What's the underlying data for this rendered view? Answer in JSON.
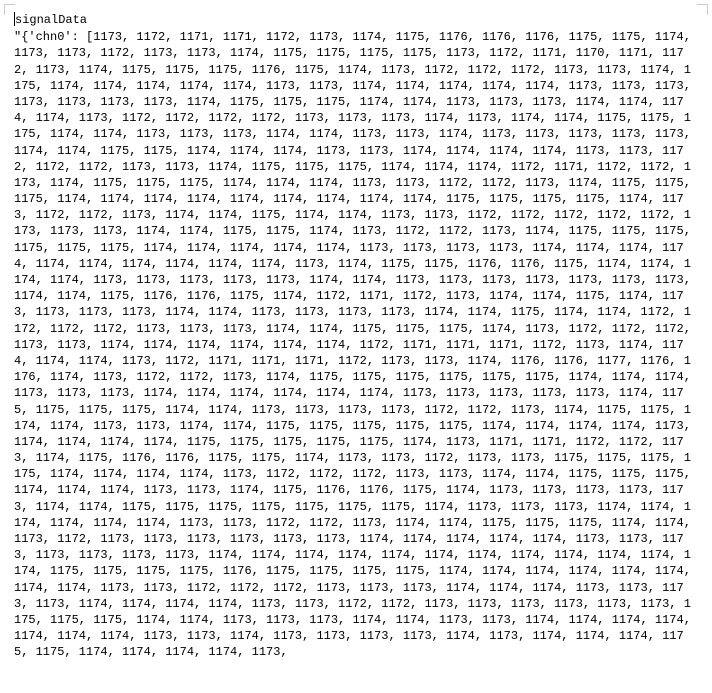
{
  "header": {
    "variable_name": "signalData"
  },
  "chart_data": {
    "type": "table",
    "title": "signalData",
    "key": "chn0",
    "prefix_literal": "\"{'chn0': [",
    "values": [
      1173,
      1172,
      1171,
      1171,
      1172,
      1173,
      1174,
      1175,
      1176,
      1176,
      1176,
      1175,
      1175,
      1174,
      1173,
      1173,
      1172,
      1173,
      1173,
      1174,
      1175,
      1175,
      1175,
      1175,
      1173,
      1172,
      1171,
      1170,
      1171,
      1172,
      1173,
      1174,
      1175,
      1175,
      1175,
      1176,
      1175,
      1174,
      1173,
      1172,
      1172,
      1172,
      1173,
      1173,
      1174,
      1175,
      1174,
      1174,
      1174,
      1174,
      1174,
      1173,
      1173,
      1174,
      1174,
      1174,
      1174,
      1174,
      1173,
      1173,
      1173,
      1173,
      1173,
      1173,
      1173,
      1174,
      1175,
      1175,
      1175,
      1174,
      1174,
      1173,
      1173,
      1173,
      1174,
      1174,
      1174,
      1174,
      1173,
      1172,
      1172,
      1172,
      1172,
      1173,
      1173,
      1173,
      1174,
      1173,
      1174,
      1174,
      1175,
      1175,
      1175,
      1174,
      1174,
      1173,
      1173,
      1173,
      1174,
      1174,
      1173,
      1173,
      1174,
      1173,
      1173,
      1173,
      1173,
      1173,
      1174,
      1174,
      1175,
      1175,
      1174,
      1174,
      1174,
      1173,
      1173,
      1174,
      1174,
      1174,
      1174,
      1173,
      1173,
      1172,
      1172,
      1172,
      1173,
      1173,
      1174,
      1175,
      1175,
      1175,
      1174,
      1174,
      1174,
      1172,
      1171,
      1172,
      1172,
      1173,
      1174,
      1175,
      1175,
      1175,
      1174,
      1174,
      1174,
      1173,
      1173,
      1172,
      1172,
      1173,
      1174,
      1175,
      1175,
      1175,
      1174,
      1174,
      1174,
      1174,
      1174,
      1174,
      1174,
      1174,
      1174,
      1175,
      1175,
      1175,
      1175,
      1174,
      1173,
      1172,
      1172,
      1173,
      1174,
      1174,
      1175,
      1174,
      1174,
      1173,
      1173,
      1172,
      1172,
      1172,
      1172,
      1172,
      1173,
      1173,
      1173,
      1174,
      1174,
      1175,
      1175,
      1174,
      1173,
      1172,
      1172,
      1173,
      1174,
      1175,
      1175,
      1175,
      1175,
      1175,
      1175,
      1174,
      1174,
      1174,
      1174,
      1174,
      1173,
      1173,
      1173,
      1173,
      1174,
      1174,
      1174,
      1174,
      1174,
      1174,
      1174,
      1174,
      1174,
      1174,
      1173,
      1174,
      1175,
      1175,
      1176,
      1176,
      1175,
      1174,
      1174,
      1174,
      1174,
      1173,
      1173,
      1173,
      1173,
      1173,
      1174,
      1174,
      1173,
      1173,
      1173,
      1173,
      1173,
      1173,
      1173,
      1174,
      1174,
      1175,
      1176,
      1176,
      1175,
      1174,
      1172,
      1171,
      1172,
      1173,
      1174,
      1174,
      1175,
      1174,
      1173,
      1173,
      1173,
      1173,
      1174,
      1174,
      1173,
      1173,
      1173,
      1173,
      1174,
      1174,
      1175,
      1174,
      1174,
      1172,
      1172,
      1172,
      1172,
      1173,
      1173,
      1173,
      1174,
      1174,
      1175,
      1175,
      1175,
      1174,
      1173,
      1172,
      1172,
      1172,
      1173,
      1173,
      1174,
      1174,
      1174,
      1174,
      1174,
      1174,
      1172,
      1171,
      1171,
      1171,
      1172,
      1173,
      1174,
      1174,
      1174,
      1174,
      1173,
      1172,
      1171,
      1171,
      1171,
      1172,
      1173,
      1173,
      1174,
      1176,
      1176,
      1177,
      1176,
      1176,
      1174,
      1173,
      1172,
      1172,
      1173,
      1174,
      1175,
      1175,
      1175,
      1175,
      1175,
      1175,
      1174,
      1174,
      1174,
      1173,
      1173,
      1173,
      1174,
      1174,
      1174,
      1174,
      1174,
      1174,
      1173,
      1173,
      1173,
      1173,
      1173,
      1174,
      1175,
      1175,
      1175,
      1175,
      1174,
      1174,
      1173,
      1173,
      1173,
      1173,
      1172,
      1172,
      1173,
      1174,
      1175,
      1175,
      1174,
      1174,
      1173,
      1173,
      1174,
      1174,
      1175,
      1175,
      1175,
      1175,
      1175,
      1174,
      1174,
      1174,
      1174,
      1173,
      1174,
      1174,
      1174,
      1174,
      1175,
      1175,
      1175,
      1175,
      1175,
      1174,
      1173,
      1171,
      1171,
      1172,
      1172,
      1173,
      1174,
      1175,
      1176,
      1176,
      1175,
      1175,
      1174,
      1173,
      1173,
      1172,
      1173,
      1173,
      1175,
      1175,
      1175,
      1175,
      1174,
      1174,
      1174,
      1174,
      1173,
      1172,
      1172,
      1172,
      1173,
      1173,
      1174,
      1174,
      1175,
      1175,
      1175,
      1174,
      1174,
      1174,
      1173,
      1173,
      1174,
      1175,
      1176,
      1176,
      1175,
      1174,
      1173,
      1173,
      1173,
      1173,
      1173,
      1174,
      1174,
      1175,
      1175,
      1175,
      1175,
      1175,
      1175,
      1175,
      1174,
      1173,
      1173,
      1173,
      1174,
      1174,
      1174,
      1174,
      1174,
      1174,
      1173,
      1173,
      1172,
      1172,
      1173,
      1174,
      1174,
      1175,
      1175,
      1175,
      1174,
      1174,
      1173,
      1172,
      1173,
      1173,
      1173,
      1173,
      1173,
      1173,
      1174,
      1174,
      1174,
      1174,
      1174,
      1173,
      1173,
      1173,
      1173,
      1173,
      1173,
      1173,
      1174,
      1174,
      1174,
      1174,
      1174,
      1174,
      1174,
      1174,
      1174,
      1174,
      1174,
      1174,
      1175,
      1175,
      1175,
      1175,
      1176,
      1175,
      1175,
      1175,
      1175,
      1174,
      1174,
      1174,
      1174,
      1174,
      1174,
      1174,
      1174,
      1173,
      1173,
      1172,
      1172,
      1172,
      1173,
      1173,
      1173,
      1174,
      1174,
      1174,
      1173,
      1173,
      1173,
      1173,
      1174,
      1174,
      1174,
      1174,
      1173,
      1173,
      1172,
      1172,
      1173,
      1173,
      1173,
      1173,
      1173,
      1173,
      1175,
      1175,
      1175,
      1174,
      1174,
      1173,
      1173,
      1173,
      1174,
      1174,
      1173,
      1173,
      1174,
      1174,
      1174,
      1174,
      1174,
      1174,
      1174,
      1173,
      1173,
      1174,
      1173,
      1173,
      1173,
      1173,
      1174,
      1173,
      1174,
      1174,
      1174,
      1175,
      1175,
      1174,
      1174,
      1174,
      1174,
      1173
    ]
  }
}
